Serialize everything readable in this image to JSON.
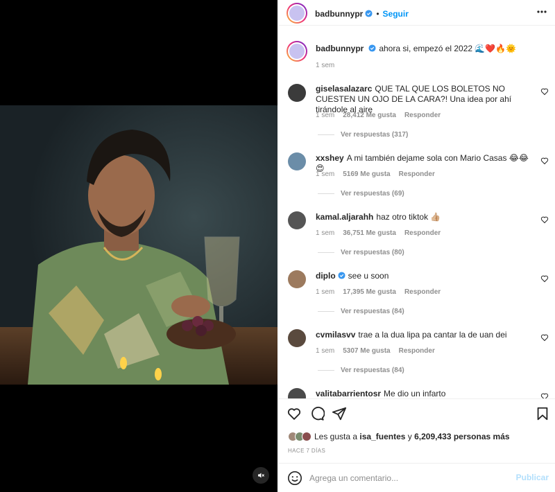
{
  "post": {
    "username": "badbunnypr",
    "follow_label": "Seguir",
    "caption": "ahora si, empezó el 2022 🌊❤️🔥🌞",
    "caption_time": "1 sem"
  },
  "comments": [
    {
      "username": "giselasalazarc",
      "text": "QUE TAL QUE LOS BOLETOS NO CUESTEN UN OJO DE LA CARA?! Una idea por ahí tirándole al aire",
      "time": "1 sem",
      "likes": "28,412 Me gusta",
      "reply_label": "Responder",
      "view_replies": "Ver respuestas (317)",
      "verified": false,
      "avatar_color": "#3b3b3b"
    },
    {
      "username": "xxshey",
      "text": "A mi también dejame sola con Mario Casas 😂😂😍",
      "time": "1 sem",
      "likes": "5169 Me gusta",
      "reply_label": "Responder",
      "view_replies": "Ver respuestas (69)",
      "verified": false,
      "avatar_color": "#6b8da8"
    },
    {
      "username": "kamal.aljarahh",
      "text": "haz otro tiktok 👍🏼",
      "time": "1 sem",
      "likes": "36,751 Me gusta",
      "reply_label": "Responder",
      "view_replies": "Ver respuestas (80)",
      "verified": false,
      "avatar_color": "#555555"
    },
    {
      "username": "diplo",
      "text": "see u soon",
      "time": "1 sem",
      "likes": "17,395 Me gusta",
      "reply_label": "Responder",
      "view_replies": "Ver respuestas (84)",
      "verified": true,
      "avatar_color": "#9c7a5e"
    },
    {
      "username": "cvmilasvv",
      "text": "trae a la dua lipa pa cantar la de uan dei",
      "time": "1 sem",
      "likes": "5307 Me gusta",
      "reply_label": "Responder",
      "view_replies": "Ver respuestas (84)",
      "verified": false,
      "avatar_color": "#5a4a3e"
    },
    {
      "username": "valitabarrientosr",
      "text": "Me dio un infarto",
      "verified": false,
      "avatar_color": "#4a4a4a"
    }
  ],
  "likes_summary": {
    "prefix": "Les gusta a",
    "user": "isa_fuentes",
    "connector": "y",
    "others": "6,209,433 personas más"
  },
  "timestamp": "HACE 7 DÍAS",
  "composer": {
    "placeholder": "Agrega un comentario...",
    "publish_label": "Publicar"
  },
  "colors": {
    "accent": "#0095f6",
    "publish_disabled": "#b2dffc",
    "verified": "#3897f0",
    "muted_text": "#8e8e8e"
  },
  "icons": [
    "more-options-icon",
    "heart-icon",
    "comment-icon",
    "share-icon",
    "bookmark-icon",
    "emoji-icon",
    "mute-icon",
    "verified-badge-icon"
  ]
}
